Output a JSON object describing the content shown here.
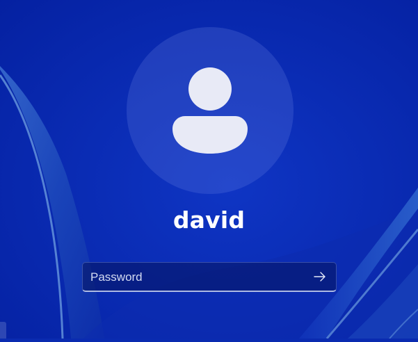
{
  "lock_screen": {
    "username": "david",
    "password_placeholder": "Password",
    "password_value": "",
    "avatar_icon": "person-icon",
    "submit_icon": "arrow-right-icon"
  },
  "colors": {
    "background_base": "#0a2bb0",
    "background_dark": "#041a8a",
    "ribbon_light": "#5f8fd8",
    "text": "#ffffff"
  }
}
